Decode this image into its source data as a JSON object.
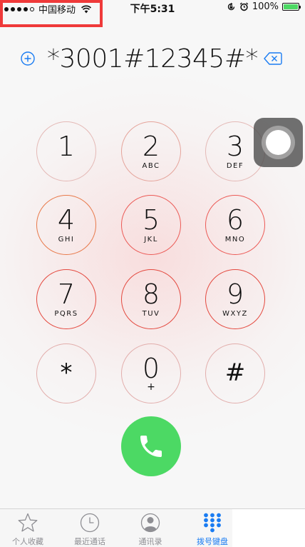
{
  "status_bar": {
    "carrier": "中国移动",
    "time": "下午5:31",
    "battery_percent": "100%",
    "battery_color": "#4cd964",
    "signal_bars_filled": 4,
    "signal_bars_total": 5,
    "highlight_color": "#ef3a3a"
  },
  "dialer": {
    "dialed_number": "*3001#12345#*",
    "add_contact_icon": "plus-circle-icon",
    "delete_icon": "backspace-icon",
    "accent_color": "#1a7cf2"
  },
  "keypad": {
    "keys": [
      {
        "digit": "1",
        "letters": ""
      },
      {
        "digit": "2",
        "letters": "ABC"
      },
      {
        "digit": "3",
        "letters": "DEF"
      },
      {
        "digit": "4",
        "letters": "GHI"
      },
      {
        "digit": "5",
        "letters": "JKL"
      },
      {
        "digit": "6",
        "letters": "MNO"
      },
      {
        "digit": "7",
        "letters": "PQRS"
      },
      {
        "digit": "8",
        "letters": "TUV"
      },
      {
        "digit": "9",
        "letters": "WXYZ"
      },
      {
        "digit": "*",
        "letters": ""
      },
      {
        "digit": "0",
        "letters": "+"
      },
      {
        "digit": "#",
        "letters": ""
      }
    ]
  },
  "call_button": {
    "icon": "phone-icon",
    "color": "#4cd964"
  },
  "tab_bar": {
    "tabs": [
      {
        "label": "个人收藏",
        "icon": "star-icon",
        "active": false
      },
      {
        "label": "最近通话",
        "icon": "clock-icon",
        "active": false
      },
      {
        "label": "通讯录",
        "icon": "contacts-icon",
        "active": false
      },
      {
        "label": "拨号键盘",
        "icon": "keypad-icon",
        "active": true
      }
    ]
  }
}
